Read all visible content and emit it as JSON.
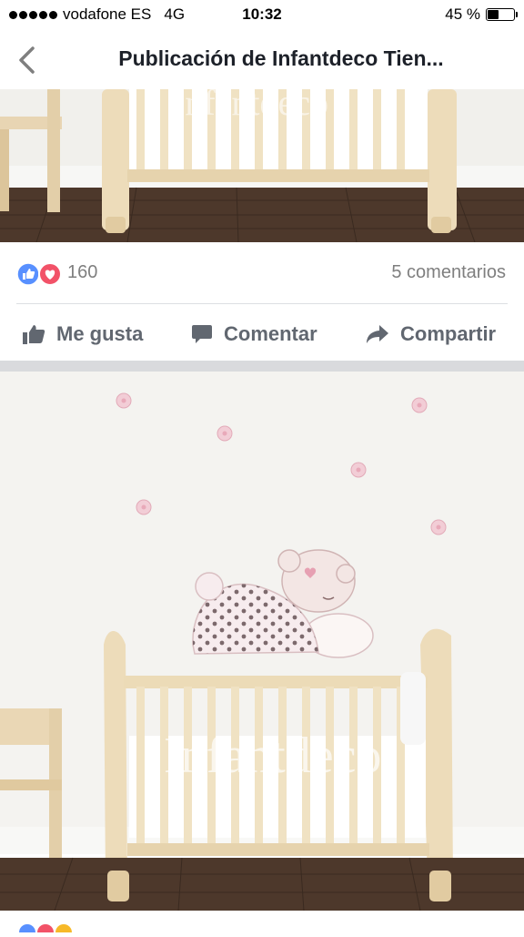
{
  "status_bar": {
    "carrier": "vodafone ES",
    "network": "4G",
    "time": "10:32",
    "battery": "45 %",
    "battery_level": 0.45
  },
  "nav": {
    "back_icon": "chevron-left-icon",
    "title": "Publicación de Infantdeco Tien..."
  },
  "post": {
    "reaction_icons": [
      "like-icon",
      "love-icon"
    ],
    "reaction_count": "160",
    "comments": "5 comentarios",
    "actions": [
      {
        "label": "Me gusta",
        "icon": "thumbs-up-icon"
      },
      {
        "label": "Comentar",
        "icon": "comment-icon"
      },
      {
        "label": "Compartir",
        "icon": "share-icon"
      }
    ]
  },
  "photo": {
    "watermark": "Infantdeco"
  },
  "colors": {
    "like_blue": "#5890ff",
    "love_red": "#f25268",
    "action_gray": "#616770",
    "count_gray": "#7f7f7f",
    "wall": "#f3f2ef",
    "floor": "#4a3528",
    "crib_wood": "#e9d9b8"
  }
}
